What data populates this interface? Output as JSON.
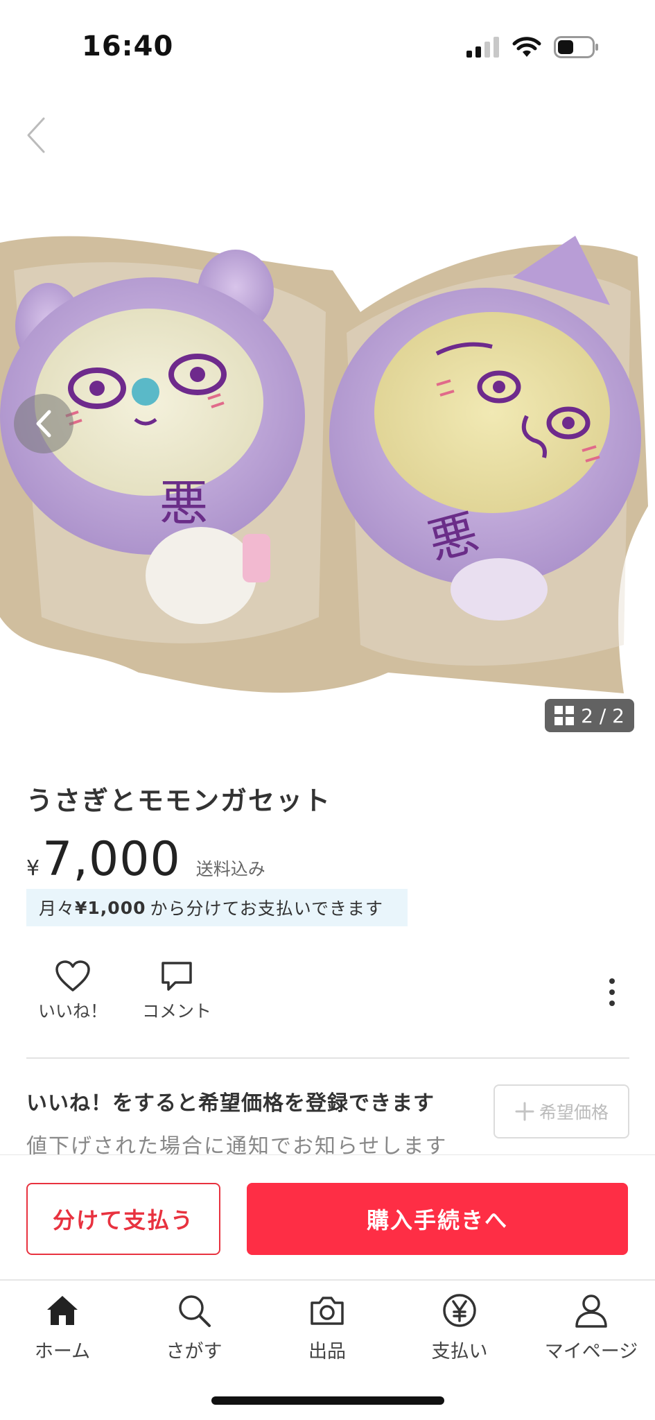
{
  "status": {
    "time": "16:40"
  },
  "item": {
    "title": "うさぎとモモンガセット",
    "currency": "¥",
    "price": "7,000",
    "shipping": "送料込み",
    "installment_prefix": "月々",
    "installment_amount": "¥1,000",
    "installment_suffix": "から分けてお支払いできます"
  },
  "gallery": {
    "current": 2,
    "total": 2,
    "counter": "2 / 2"
  },
  "actions": {
    "like_label": "いいね！",
    "comment_label": "コメント"
  },
  "wish_price": {
    "title": "いいね！をすると希望価格を登録できます",
    "subtitle": "値下げされた場合に通知でお知らせします",
    "button_label": "希望価格"
  },
  "purchase": {
    "split_label": "分けて支払う",
    "buy_label": "購入手続きへ"
  },
  "tabs": [
    {
      "label": "ホーム",
      "icon": "home-icon"
    },
    {
      "label": "さがす",
      "icon": "search-icon"
    },
    {
      "label": "出品",
      "icon": "camera-icon"
    },
    {
      "label": "支払い",
      "icon": "yen-icon"
    },
    {
      "label": "マイページ",
      "icon": "person-icon"
    }
  ],
  "colors": {
    "accent": "#fe2e45",
    "split_border": "#e8323f",
    "installment_bg": "#e9f5fb"
  }
}
